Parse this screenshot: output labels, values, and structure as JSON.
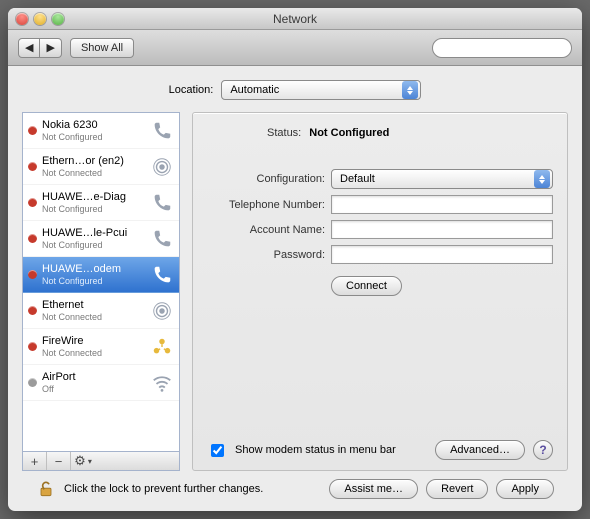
{
  "window": {
    "title": "Network"
  },
  "toolbar": {
    "back_label": "◀",
    "forward_label": "▶",
    "show_all_label": "Show All",
    "search_placeholder": ""
  },
  "location": {
    "label": "Location:",
    "value": "Automatic"
  },
  "services": [
    {
      "name": "Nokia 6230",
      "status": "Not Configured",
      "icon": "phone",
      "dot": "red",
      "selected": false
    },
    {
      "name": "Ethern…or (en2)",
      "status": "Not Connected",
      "icon": "ethernet",
      "dot": "red",
      "selected": false
    },
    {
      "name": "HUAWE…e-Diag",
      "status": "Not Configured",
      "icon": "phone",
      "dot": "red",
      "selected": false
    },
    {
      "name": "HUAWE…le-Pcui",
      "status": "Not Configured",
      "icon": "phone",
      "dot": "red",
      "selected": false
    },
    {
      "name": "HUAWE…odem",
      "status": "Not Configured",
      "icon": "phone",
      "dot": "red",
      "selected": true
    },
    {
      "name": "Ethernet",
      "status": "Not Connected",
      "icon": "ethernet",
      "dot": "red",
      "selected": false
    },
    {
      "name": "FireWire",
      "status": "Not Connected",
      "icon": "firewire",
      "dot": "red",
      "selected": false
    },
    {
      "name": "AirPort",
      "status": "Off",
      "icon": "wifi",
      "dot": "off",
      "selected": false
    }
  ],
  "footer_buttons": {
    "add": "+",
    "remove": "−",
    "gear": "⚙",
    "gear_menu": "▾"
  },
  "detail": {
    "status_label": "Status:",
    "status_value": "Not Configured",
    "configuration_label": "Configuration:",
    "configuration_value": "Default",
    "telephone_label": "Telephone Number:",
    "telephone_value": "",
    "account_label": "Account Name:",
    "account_value": "",
    "password_label": "Password:",
    "password_value": "",
    "connect_label": "Connect",
    "show_modem_label": "Show modem status in menu bar",
    "show_modem_checked": true,
    "advanced_label": "Advanced…",
    "help_label": "?"
  },
  "lock": {
    "text": "Click the lock to prevent further changes."
  },
  "buttons": {
    "assist": "Assist me…",
    "revert": "Revert",
    "apply": "Apply"
  }
}
